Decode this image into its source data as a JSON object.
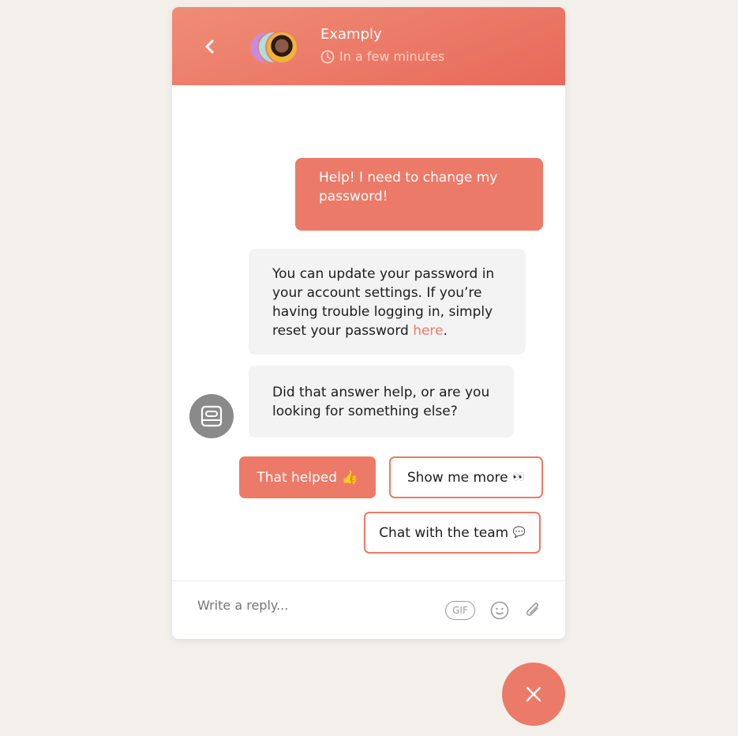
{
  "header": {
    "title": "Examply",
    "status": "In a few minutes",
    "back_icon": "chevron-left-icon",
    "status_icon": "clock-icon"
  },
  "colors": {
    "accent": "#ec7a68",
    "background": "#f3f0eb",
    "bot_bubble": "#f3f3f3",
    "bot_avatar": "#8a8a8a"
  },
  "messages": [
    {
      "from": "user",
      "text": "Help! I need to change my password!"
    },
    {
      "from": "bot",
      "text_before": "You can update your password in your account settings. If you’re having trouble logging in, simply reset your password ",
      "link": "here",
      "text_after": "."
    },
    {
      "from": "bot",
      "text": "Did that answer help, or are you looking for something else?"
    }
  ],
  "quick_replies": [
    {
      "label": "That helped",
      "emoji": "👍"
    },
    {
      "label": "Show me more",
      "emoji": "👀"
    },
    {
      "label": "Chat with the team",
      "emoji": "💬"
    }
  ],
  "composer": {
    "placeholder": "Write a reply...",
    "gif_label": "GIF"
  }
}
